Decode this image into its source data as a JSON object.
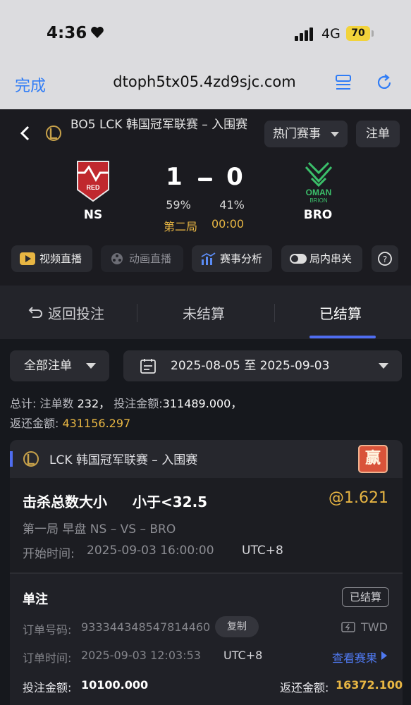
{
  "status_bar": {
    "time": "4:36",
    "network": "4G",
    "battery": "70"
  },
  "browser": {
    "done": "完成",
    "url": "dtoph5tx05.4zd9sjc.com"
  },
  "match": {
    "title": "BO5 LCK 韩国冠军联赛 – 入围赛",
    "hot_label": "热门赛事",
    "slip_label": "注单",
    "team_left": "NS",
    "team_right": "BRO",
    "score_left": "1",
    "score_right": "0",
    "pct_left": "59%",
    "pct_right": "41%",
    "game_label": "第二局",
    "game_clock": "00:00"
  },
  "actions": [
    {
      "label": "视频直播",
      "icon": "play-icon"
    },
    {
      "label": "动画直播",
      "icon": "animation-icon"
    },
    {
      "label": "赛事分析",
      "icon": "analysis-icon"
    },
    {
      "label": "局内串关",
      "icon": "toggle-icon"
    }
  ],
  "tabs": {
    "back": "返回投注",
    "unsettled": "未结算",
    "settled": "已结算"
  },
  "filters": {
    "all": "全部注单",
    "date_range": "2025-08-05 至 2025-09-03"
  },
  "summary": {
    "line1_prefix": "总计:",
    "count_label": "注单数",
    "count": "232，",
    "stake_label": "投注金额:",
    "stake": "311489.000，",
    "return_label": "返还金额:",
    "return": "431156.297"
  },
  "bet": {
    "league": "LCK 韩国冠军联赛 – 入围赛",
    "result_badge": "赢",
    "market": "击杀总数大小",
    "pick": "小于<32.5",
    "odds": "@1.621",
    "detail": "第一局 早盘 NS – VS – BRO",
    "start_label": "开始时间:",
    "start_time": "2025-09-03 16:00:00",
    "start_tz": "UTC+8",
    "slip_type": "单注",
    "status": "已结算",
    "order_no_label": "订单号码:",
    "order_no": "933344348547814460",
    "copy": "复制",
    "currency": "TWD",
    "order_time_label": "订单时间:",
    "order_time": "2025-09-03 12:03:53",
    "order_tz": "UTC+8",
    "view_result": "查看赛果",
    "stake_label": "投注金额:",
    "stake": "10100.000",
    "return_label": "返还金额:",
    "return": "16372.100"
  },
  "colors": {
    "accent": "#4f6df0",
    "gold": "#e8b643",
    "link": "#2f7cf6",
    "win": "#d9533a"
  }
}
